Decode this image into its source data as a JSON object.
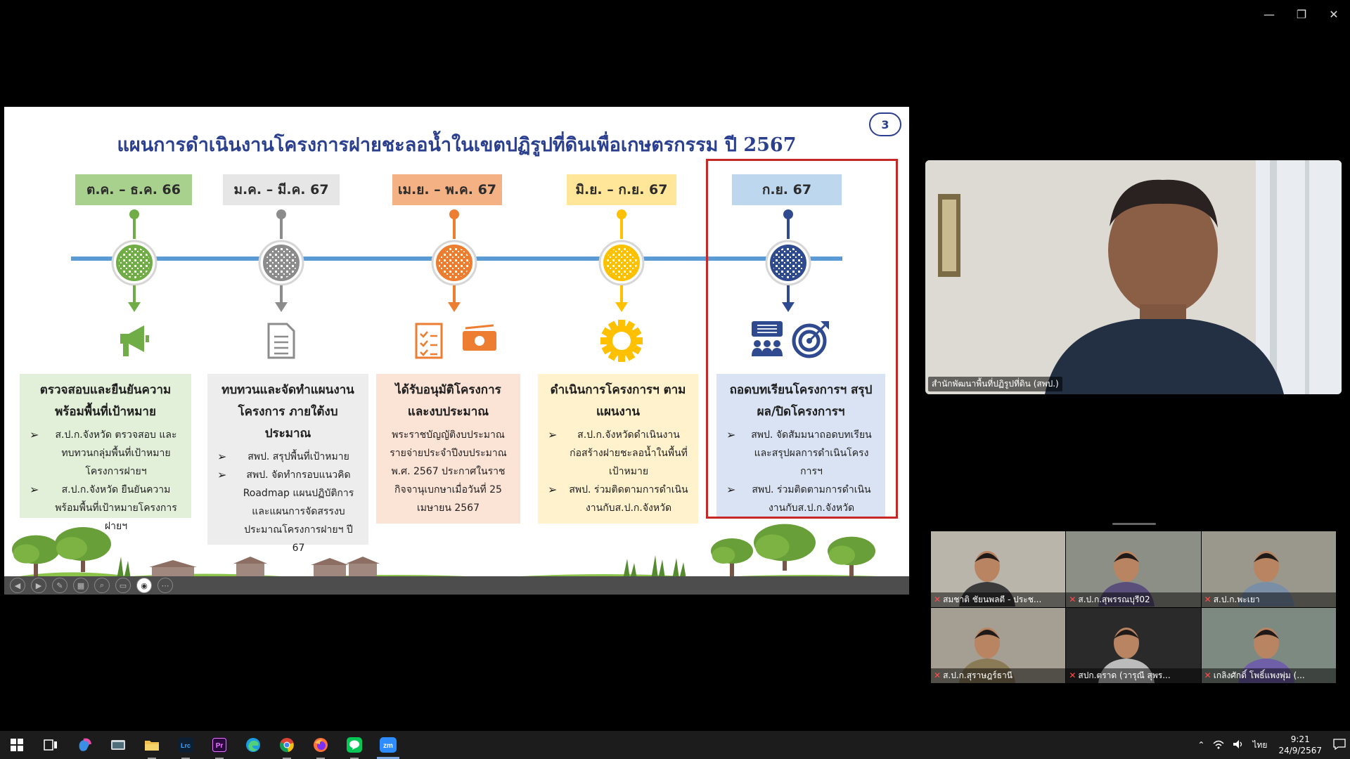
{
  "slide": {
    "title": "แผนการดำเนินงานโครงการฝายชะลอน้ำในเขตปฏิรูปที่ดินเพื่อเกษตรกรรม ปี 2567",
    "page_number": "3",
    "colors": {
      "title": "#2b3f8f",
      "timeline_line": "#5b9bd5",
      "highlight_border": "#c62828"
    },
    "stages": [
      {
        "period": "ต.ค. – ธ.ค. 66",
        "period_bg": "#a9d18e",
        "accent": "#70ad47",
        "icon": "megaphone-icon",
        "card_bg": "#e2efd9",
        "heading": "ตรวจสอบและยืนยันความพร้อมพื้นที่เป้าหมาย",
        "bullets": [
          "ส.ป.ก.จังหวัด ตรวจสอบ และทบทวนกลุ่มพื้นที่เป้าหมายโครงการฝายฯ",
          "ส.ป.ก.จังหวัด ยืนยันความพร้อมพื้นที่เป้าหมายโครงการฝายฯ"
        ]
      },
      {
        "period": "ม.ค. – มี.ค. 67",
        "period_bg": "#e7e6e6",
        "accent": "#8c8c8c",
        "icon": "document-icon",
        "card_bg": "#ededed",
        "heading": "ทบทวนและจัดทำแผนงานโครงการ ภายใต้งบประมาณ",
        "bullets": [
          "สพป. สรุปพื้นที่เป้าหมาย",
          "สพป. จัดทำกรอบแนวคิด Roadmap แผนปฏิบัติการ และแผนการจัดสรรงบประมาณโครงการฝายฯ ปี 67"
        ]
      },
      {
        "period": "เม.ย. – พ.ค. 67",
        "period_bg": "#f4b183",
        "accent": "#ed7d31",
        "icon": "checklist-icon",
        "icon2": "money-icon",
        "card_bg": "#fbe3d6",
        "heading": "ได้รับอนุมัติโครงการและงบประมาณ",
        "text": "พระราชบัญญัติงบประมาณรายจ่ายประจำปีงบประมาณ พ.ศ. 2567 ประกาศในราชกิจจานุเบกษาเมื่อวันที่ 25 เมษายน 2567"
      },
      {
        "period": "มิ.ย. – ก.ย. 67",
        "period_bg": "#ffe699",
        "accent": "#ffc000",
        "icon": "gear-icon",
        "card_bg": "#fff2cc",
        "heading": "ดำเนินการโครงการฯ ตามแผนงาน",
        "bullets": [
          "ส.ป.ก.จังหวัดดำเนินงานก่อสร้างฝายชะลอน้ำในพื้นที่เป้าหมาย",
          "สพป. ร่วมติดตามการดำเนินงานกับส.ป.ก.จังหวัด"
        ]
      },
      {
        "period": "ก.ย. 67",
        "period_bg": "#bdd7ee",
        "accent": "#2f4a8f",
        "icon": "meeting-icon",
        "icon2": "target-icon",
        "card_bg": "#dae3f3",
        "heading": "ถอดบทเรียนโครงการฯ สรุปผล/ปิดโครงการฯ",
        "bullets": [
          "สพป. จัดสัมมนาถอดบทเรียนและสรุปผลการดำเนินโครงการฯ",
          "สพป. ร่วมติดตามการดำเนินงานกับส.ป.ก.จังหวัด"
        ]
      }
    ],
    "toolbar_icons": [
      "prev-icon",
      "next-icon",
      "pen-icon",
      "slides-icon",
      "zoom-icon",
      "subtitle-icon",
      "camera-icon",
      "more-icon"
    ]
  },
  "speaker": {
    "name": "สำนักพัฒนาพื้นที่ปฏิรูปที่ดิน (สพป.)"
  },
  "participants": [
    {
      "name": "สมชาติ ชัยนพลตี - ประช...",
      "bg": "#b9b5ab"
    },
    {
      "name": "ส.ป.ก.สุพรรณบุรี02",
      "bg": "#8c8f86"
    },
    {
      "name": "ส.ป.ก.พะเยา",
      "bg": "#9a978c"
    },
    {
      "name": "ส.ป.ก.สุราษฎร์ธานี",
      "bg": "#a59f93"
    },
    {
      "name": "สปก.ตราด (วารุณี สุพร...",
      "bg": "#2a2a2a"
    },
    {
      "name": "เกลิงศักดิ์ โพธิ์แพงพุ่ม (...",
      "bg": "#7d8a82"
    }
  ],
  "taskbar": {
    "apps": [
      "windows-start-icon",
      "task-view-icon",
      "copilot-icon",
      "explorer-icon",
      "file-folder-icon",
      "lightroom-icon",
      "premiere-icon",
      "edge-icon",
      "chrome-icon",
      "firefox-icon",
      "line-icon",
      "zoom-icon"
    ],
    "lightroom_label": "Lrc",
    "premiere_label": "Pr",
    "zoom_label": "zm",
    "language": "ไทย",
    "time": "9:21",
    "date": "24/9/2567"
  }
}
